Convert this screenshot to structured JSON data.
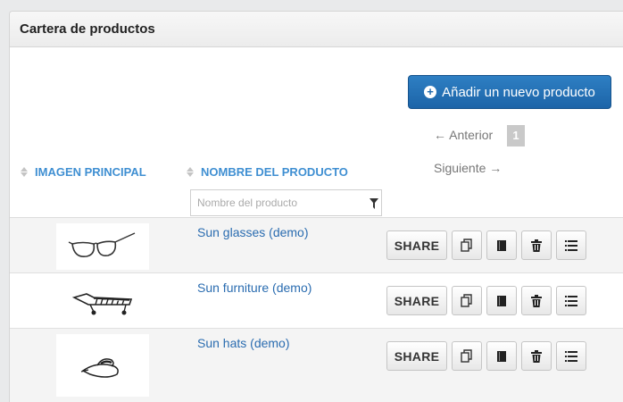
{
  "panel": {
    "title": "Cartera de productos"
  },
  "actions": {
    "add_product_label": "Añadir un nuevo producto"
  },
  "pagination": {
    "prev_label": "← Anterior",
    "current_page": "1",
    "next_label": "Siguiente →"
  },
  "table": {
    "columns": [
      {
        "label": "IMAGEN PRINCIPAL"
      },
      {
        "label": "NOMBRE DEL PRODUCTO"
      }
    ],
    "filter": {
      "placeholder": "Nombre del producto"
    },
    "share_label": "SHARE",
    "rows": [
      {
        "name": "Sun glasses (demo)",
        "image": "sunglasses-sketch"
      },
      {
        "name": "Sun furniture (demo)",
        "image": "sun-lounger-sketch"
      },
      {
        "name": "Sun hats (demo)",
        "image": "sun-hat-sketch"
      }
    ],
    "row_icons": [
      "copy-icon",
      "book-icon",
      "trash-icon",
      "list-icon"
    ]
  },
  "colors": {
    "accent": "#2371b8",
    "link": "#2a6cb0",
    "header_text": "#3f8fd2",
    "button_primary": "#1f69ad"
  }
}
